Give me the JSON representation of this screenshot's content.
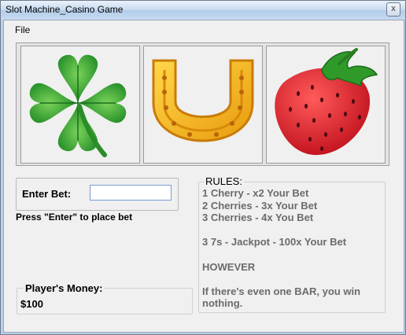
{
  "window": {
    "title": "Slot Machine_Casino Game",
    "close_glyph": "x"
  },
  "menu": {
    "file": "File"
  },
  "reels": [
    {
      "symbol": "clover-icon"
    },
    {
      "symbol": "horseshoe-icon"
    },
    {
      "symbol": "strawberry-icon"
    }
  ],
  "bet": {
    "label": "Enter Bet:",
    "value": "",
    "placeholder": "",
    "hint": "Press \"Enter\" to place bet"
  },
  "money": {
    "label": "Player's Money:",
    "value": "$100"
  },
  "rules": {
    "title": "RULES:",
    "lines": [
      "1 Cherry - x2 Your Bet",
      "2 Cherries - 3x Your Bet",
      "3 Cherries - 4x You Bet",
      "",
      "3 7s - Jackpot - 100x Your Bet",
      "",
      "HOWEVER",
      "",
      "If there's even one BAR, you win",
      "nothing."
    ]
  },
  "colors": {
    "clover": "#2e9e2a",
    "horseshoe": "#f2b619",
    "strawberry": "#e0202d",
    "leaf": "#2f8f2a"
  }
}
